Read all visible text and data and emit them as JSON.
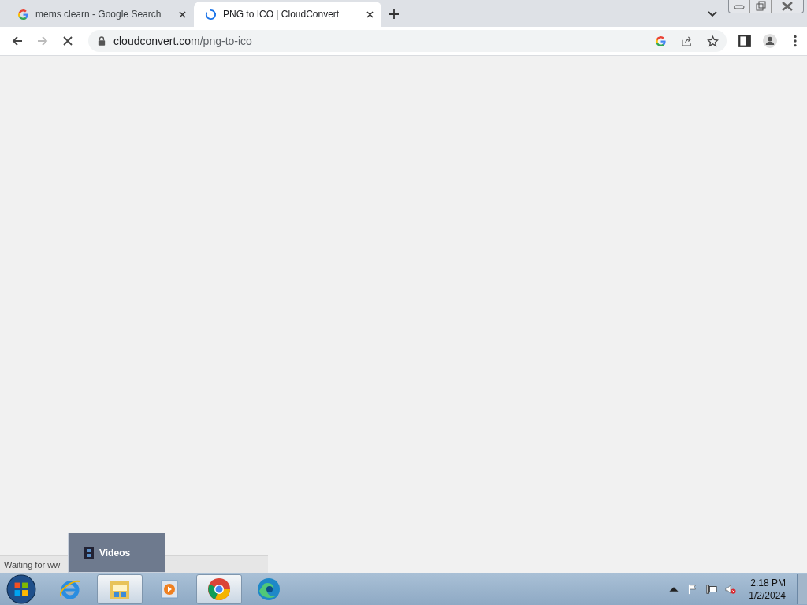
{
  "tabs": [
    {
      "title": "mems clearn - Google Search",
      "kind": "google",
      "selected": false
    },
    {
      "title": "PNG to ICO | CloudConvert",
      "kind": "loading",
      "selected": true
    }
  ],
  "toolbar": {
    "back_disabled": false,
    "forward_disabled": true,
    "url_domain": "cloudconvert.com",
    "url_path": "/png-to-ico"
  },
  "status_bubble": "Waiting for ww",
  "taskbar_popup": {
    "label": "Videos"
  },
  "taskbar": {
    "apps": [
      {
        "kind": "ie",
        "highlighted": false
      },
      {
        "kind": "explorer",
        "highlighted": true
      },
      {
        "kind": "media",
        "highlighted": false
      },
      {
        "kind": "chrome",
        "highlighted": true
      },
      {
        "kind": "edge",
        "highlighted": false
      }
    ],
    "time": "2:18 PM",
    "date": "1/2/2024"
  }
}
